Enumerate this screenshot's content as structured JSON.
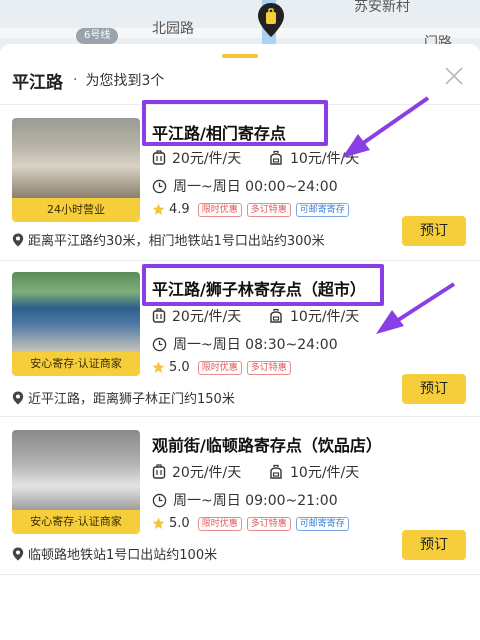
{
  "map": {
    "labels": {
      "road": "北园路",
      "area": "苏安新村",
      "road_right": "门路",
      "metro_line": "6号线"
    }
  },
  "header": {
    "title": "平江路",
    "separator": "·",
    "result_text": "为您找到3个"
  },
  "colors": {
    "accent": "#f6cd3b",
    "highlight": "#8a3ee5",
    "badge_red": "#e05a5a",
    "badge_blue": "#3b7bd6"
  },
  "stores": [
    {
      "name": "平江路/相门寄存点",
      "price_small": "20元/件/天",
      "price_large": "10元/件/天",
      "hours": "周一~周日 00:00~24:00",
      "rating": "4.9",
      "badges": [
        "限时优惠",
        "多订特惠",
        "可邮寄寄存"
      ],
      "thumb_tag": "24小时营业",
      "address": "距离平江路约30米，相门地铁站1号口出站约300米",
      "book_label": "预订"
    },
    {
      "name": "平江路/狮子林寄存点（超市）",
      "price_small": "20元/件/天",
      "price_large": "10元/件/天",
      "hours": "周一~周日 08:30~24:00",
      "rating": "5.0",
      "badges": [
        "限时优惠",
        "多订特惠"
      ],
      "thumb_tag": "安心寄存·认证商家",
      "address": "近平江路，距离狮子林正门约150米",
      "book_label": "预订"
    },
    {
      "name": "观前街/临顿路寄存点（饮品店）",
      "price_small": "20元/件/天",
      "price_large": "10元/件/天",
      "hours": "周一~周日 09:00~21:00",
      "rating": "5.0",
      "badges": [
        "限时优惠",
        "多订特惠",
        "可邮寄寄存"
      ],
      "thumb_tag": "安心寄存·认证商家",
      "address": "临顿路地铁站1号口出站约100米",
      "book_label": "预订"
    }
  ],
  "icons": {
    "suitcase": "suitcase-icon",
    "bag": "backpack-icon",
    "clock": "clock-icon",
    "star": "star-icon",
    "location": "location-pin-icon",
    "close": "close-icon"
  }
}
